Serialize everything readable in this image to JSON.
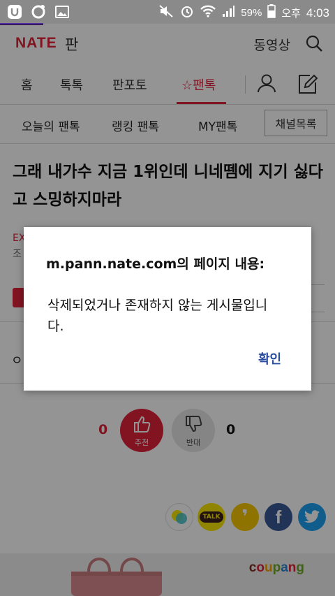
{
  "status_bar": {
    "battery": "59%",
    "time_period": "오후",
    "time": "4:03"
  },
  "header": {
    "logo": "NATE",
    "logo_sub": "판",
    "video_link": "동영상",
    "search_icon": "search-icon"
  },
  "nav": {
    "items": [
      "홈",
      "톡톡",
      "판포토",
      "팬톡"
    ],
    "active": "팬톡",
    "star_glyph": "☆",
    "user_icon": "user-icon",
    "edit_icon": "edit-icon"
  },
  "subnav": {
    "items": [
      "오늘의 팬톡",
      "랭킹 팬톡",
      "MY팬톡"
    ],
    "channel_button": "채널목록"
  },
  "article": {
    "title": "그래 내가수 지금 1위인데 니네뗌에 지기 싫다고 스밍하지마라",
    "meta_prefix": "EX",
    "meta_sub": "조",
    "badge": "판",
    "body_start": "ㅇ"
  },
  "vote": {
    "up_count": "0",
    "up_label": "추천",
    "down_count": "0",
    "down_label": "반대"
  },
  "share": {
    "kakao_talk": "TALK",
    "kakao_story": "❜",
    "facebook": "f"
  },
  "ad": {
    "brand": "coupang"
  },
  "dialog": {
    "title": "m.pann.nate.com의 페이지 내용:",
    "message": "삭제되었거나 존재하지 않는 게시물입니다.",
    "ok_button": "확인"
  },
  "colors": {
    "brand_red": "#e0243b",
    "dialog_ok": "#2b4ea0",
    "facebook": "#3b5998",
    "twitter": "#1da1f2",
    "kakao_yellow": "#f7e600"
  }
}
